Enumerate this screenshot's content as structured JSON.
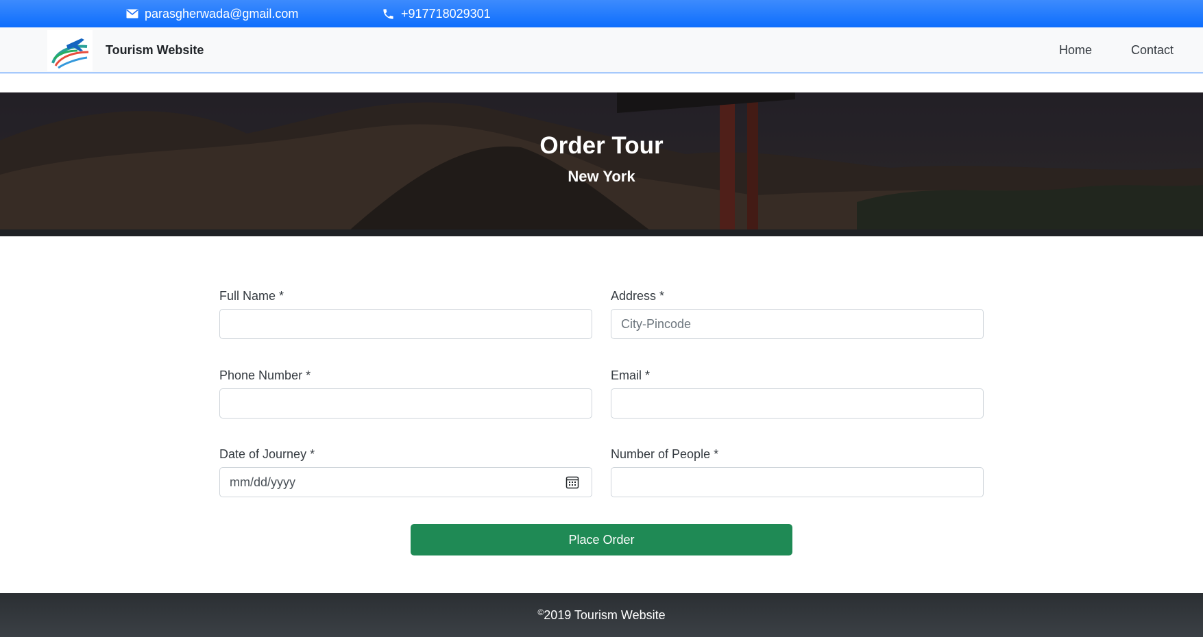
{
  "topbar": {
    "email": "parasgherwada@gmail.com",
    "phone": "+917718029301",
    "email_icon": "envelope-icon",
    "phone_icon": "phone-icon",
    "color": "#0d6efd"
  },
  "navbar": {
    "brand": "Tourism Website",
    "logo_icon": "airplane-logo-icon",
    "links": [
      {
        "label": "Home"
      },
      {
        "label": "Contact"
      }
    ]
  },
  "hero": {
    "title": "Order Tour",
    "subtitle": "New York"
  },
  "form": {
    "full_name": {
      "label": "Full Name *",
      "value": "",
      "placeholder": ""
    },
    "address": {
      "label": "Address *",
      "value": "",
      "placeholder": "City-Pincode"
    },
    "phone": {
      "label": "Phone Number *",
      "value": "",
      "placeholder": ""
    },
    "email": {
      "label": "Email *",
      "value": "",
      "placeholder": ""
    },
    "date": {
      "label": "Date of Journey *",
      "value": "mm/dd/yyyy",
      "icon": "calendar-icon"
    },
    "people": {
      "label": "Number of People *",
      "value": "",
      "placeholder": ""
    },
    "submit_label": "Place Order",
    "submit_color": "#1f8a55"
  },
  "footer": {
    "copyright_symbol": "©",
    "text": "2019 Tourism Website"
  }
}
